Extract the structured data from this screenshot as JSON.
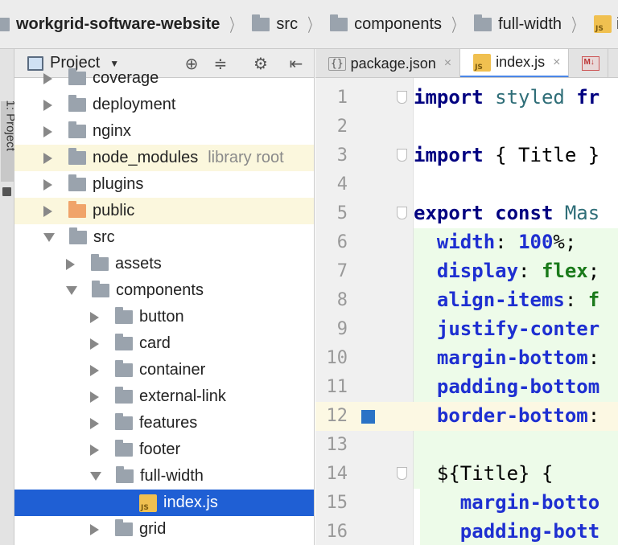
{
  "breadcrumb": {
    "items": [
      {
        "label": "workgrid-software-website",
        "bold": true
      },
      {
        "label": "src"
      },
      {
        "label": "components"
      },
      {
        "label": "full-width"
      },
      {
        "label": "ind"
      }
    ]
  },
  "toolstrip": {
    "label": "1: Project"
  },
  "project_panel": {
    "title": "Project",
    "caret": "▼",
    "tree": [
      {
        "label": "coverage",
        "depth": 0,
        "arrow": "right",
        "icon": "folder"
      },
      {
        "label": "deployment",
        "depth": 0,
        "arrow": "right",
        "icon": "folder"
      },
      {
        "label": "nginx",
        "depth": 0,
        "arrow": "right",
        "icon": "folder"
      },
      {
        "label": "node_modules",
        "depth": 0,
        "arrow": "right",
        "icon": "folder",
        "note": "library root",
        "highlight": true
      },
      {
        "label": "plugins",
        "depth": 0,
        "arrow": "right",
        "icon": "folder"
      },
      {
        "label": "public",
        "depth": 0,
        "arrow": "right",
        "icon": "folder-orange",
        "highlight": true
      },
      {
        "label": "src",
        "depth": 0,
        "arrow": "down",
        "icon": "folder"
      },
      {
        "label": "assets",
        "depth": 1,
        "arrow": "right",
        "icon": "folder"
      },
      {
        "label": "components",
        "depth": 1,
        "arrow": "down",
        "icon": "folder"
      },
      {
        "label": "button",
        "depth": 2,
        "arrow": "right",
        "icon": "folder"
      },
      {
        "label": "card",
        "depth": 2,
        "arrow": "right",
        "icon": "folder"
      },
      {
        "label": "container",
        "depth": 2,
        "arrow": "right",
        "icon": "folder"
      },
      {
        "label": "external-link",
        "depth": 2,
        "arrow": "right",
        "icon": "folder"
      },
      {
        "label": "features",
        "depth": 2,
        "arrow": "right",
        "icon": "folder"
      },
      {
        "label": "footer",
        "depth": 2,
        "arrow": "right",
        "icon": "folder"
      },
      {
        "label": "full-width",
        "depth": 2,
        "arrow": "down",
        "icon": "folder"
      },
      {
        "label": "index.js",
        "depth": 3,
        "arrow": "none",
        "icon": "js",
        "selected": true
      },
      {
        "label": "grid",
        "depth": 2,
        "arrow": "right",
        "icon": "folder"
      }
    ]
  },
  "tabs": [
    {
      "label": "package.json",
      "icon": "json",
      "close": "×"
    },
    {
      "label": "index.js",
      "icon": "js",
      "close": "×",
      "active": true
    },
    {
      "label": "",
      "icon": "md"
    }
  ],
  "editor": {
    "current_line": 12,
    "lines": [
      {
        "n": "1",
        "fold": true,
        "tokens": [
          {
            "t": "import",
            "c": "kw"
          },
          {
            "t": " styled ",
            "c": "id"
          },
          {
            "t": "fr",
            "c": "kw"
          }
        ]
      },
      {
        "n": "2",
        "tokens": []
      },
      {
        "n": "3",
        "fold": true,
        "tokens": [
          {
            "t": "import",
            "c": "kw"
          },
          {
            "t": " { Title }",
            "c": "plain"
          }
        ]
      },
      {
        "n": "4",
        "tokens": []
      },
      {
        "n": "5",
        "fold": true,
        "tokens": [
          {
            "t": "export const",
            "c": "kw"
          },
          {
            "t": " Mas",
            "c": "id"
          }
        ]
      },
      {
        "n": "6",
        "bg": 1,
        "tokens": [
          {
            "t": "  width",
            "c": "prop"
          },
          {
            "t": ": ",
            "c": "plain"
          },
          {
            "t": "100",
            "c": "prop"
          },
          {
            "t": "%;",
            "c": "plain"
          }
        ]
      },
      {
        "n": "7",
        "bg": 1,
        "tokens": [
          {
            "t": "  display",
            "c": "prop"
          },
          {
            "t": ": ",
            "c": "plain"
          },
          {
            "t": "flex",
            "c": "val"
          },
          {
            "t": ";",
            "c": "plain"
          }
        ]
      },
      {
        "n": "8",
        "bg": 1,
        "tokens": [
          {
            "t": "  align-items",
            "c": "prop"
          },
          {
            "t": ": ",
            "c": "plain"
          },
          {
            "t": "f",
            "c": "val"
          }
        ]
      },
      {
        "n": "9",
        "bg": 1,
        "tokens": [
          {
            "t": "  justify-conter",
            "c": "prop"
          }
        ]
      },
      {
        "n": "10",
        "bg": 1,
        "tokens": [
          {
            "t": "  margin-bottom",
            "c": "prop"
          },
          {
            "t": ":",
            "c": "plain"
          }
        ]
      },
      {
        "n": "11",
        "bg": 1,
        "tokens": [
          {
            "t": "  padding-bottom",
            "c": "prop"
          }
        ]
      },
      {
        "n": "12",
        "bg": 1,
        "bookmark": true,
        "tokens": [
          {
            "t": "  border-bottom",
            "c": "prop"
          },
          {
            "t": ":",
            "c": "plain"
          }
        ]
      },
      {
        "n": "13",
        "bg": 1,
        "tokens": []
      },
      {
        "n": "14",
        "bg": 1,
        "fold": true,
        "tokens": [
          {
            "t": "  ${Title}",
            "c": "plain"
          },
          {
            "t": " {",
            "c": "plain"
          }
        ]
      },
      {
        "n": "15",
        "bg": 2,
        "tokens": [
          {
            "t": "    margin-botto",
            "c": "prop"
          }
        ]
      },
      {
        "n": "16",
        "bg": 2,
        "tokens": [
          {
            "t": "    padding-bott",
            "c": "prop"
          }
        ]
      }
    ]
  }
}
